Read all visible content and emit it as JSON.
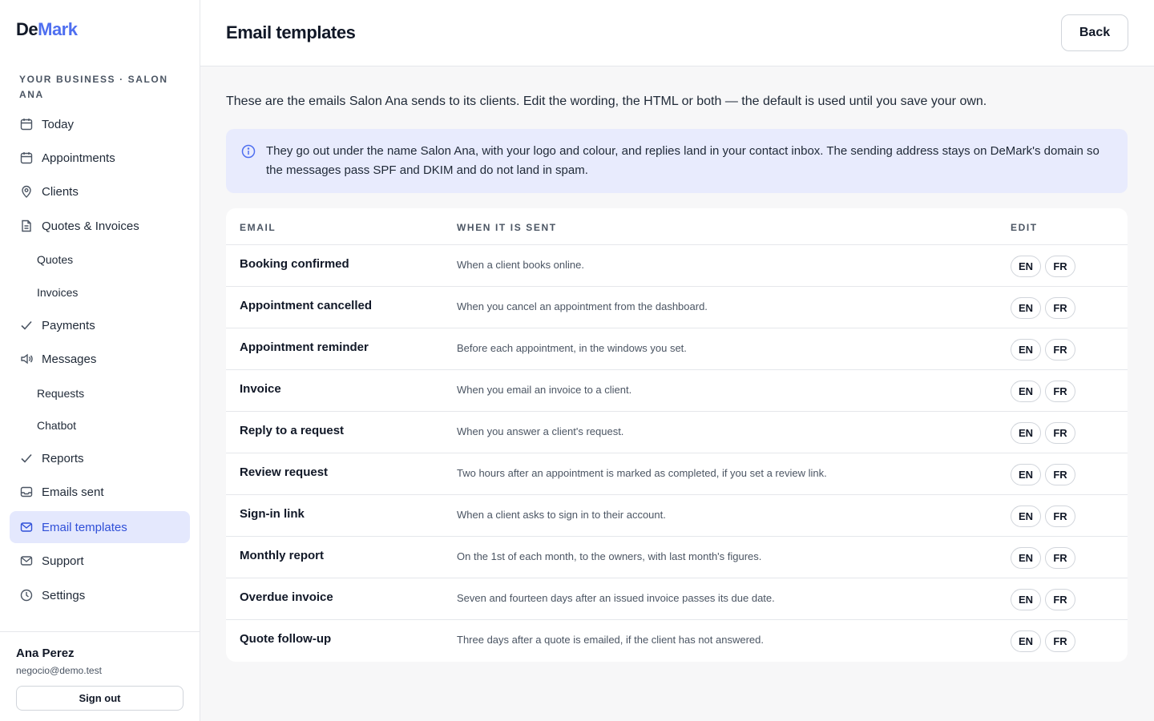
{
  "brand": {
    "part1": "De",
    "part2": "Mark"
  },
  "business_label": "YOUR BUSINESS · SALON ANA",
  "nav": [
    {
      "label": "Today",
      "icon": "calendar-icon"
    },
    {
      "label": "Appointments",
      "icon": "calendar-icon"
    },
    {
      "label": "Clients",
      "icon": "map-pin-icon"
    },
    {
      "label": "Quotes & Invoices",
      "icon": "document-icon"
    },
    {
      "label": "Quotes"
    },
    {
      "label": "Invoices"
    },
    {
      "label": "Payments",
      "icon": "check-icon"
    },
    {
      "label": "Messages",
      "icon": "speaker-icon"
    },
    {
      "label": "Requests"
    },
    {
      "label": "Chatbot"
    },
    {
      "label": "Reports",
      "icon": "check-icon"
    },
    {
      "label": "Emails sent",
      "icon": "inbox-icon"
    },
    {
      "label": "Email templates",
      "icon": "mail-icon",
      "active": true
    },
    {
      "label": "Support",
      "icon": "mail-icon"
    },
    {
      "label": "Settings",
      "icon": "clock-icon"
    }
  ],
  "user": {
    "name": "Ana Perez",
    "email": "negocio@demo.test",
    "signout_label": "Sign out"
  },
  "header": {
    "title": "Email templates",
    "back_label": "Back"
  },
  "intro": "These are the emails Salon Ana sends to its clients. Edit the wording, the HTML or both — the default is used until you save your own.",
  "info": "They go out under the name Salon Ana, with your logo and colour, and replies land in your contact inbox. The sending address stays on DeMark's domain so the messages pass SPF and DKIM and do not land in spam.",
  "table": {
    "headers": {
      "email": "EMAIL",
      "when": "WHEN IT IS SENT",
      "edit": "EDIT"
    },
    "lang_en": "EN",
    "lang_fr": "FR",
    "rows": [
      {
        "name": "Booking confirmed",
        "when": "When a client books online."
      },
      {
        "name": "Appointment cancelled",
        "when": "When you cancel an appointment from the dashboard."
      },
      {
        "name": "Appointment reminder",
        "when": "Before each appointment, in the windows you set."
      },
      {
        "name": "Invoice",
        "when": "When you email an invoice to a client."
      },
      {
        "name": "Reply to a request",
        "when": "When you answer a client's request."
      },
      {
        "name": "Review request",
        "when": "Two hours after an appointment is marked as completed, if you set a review link."
      },
      {
        "name": "Sign-in link",
        "when": "When a client asks to sign in to their account."
      },
      {
        "name": "Monthly report",
        "when": "On the 1st of each month, to the owners, with last month's figures."
      },
      {
        "name": "Overdue invoice",
        "when": "Seven and fourteen days after an issued invoice passes its due date."
      },
      {
        "name": "Quote follow-up",
        "when": "Three days after a quote is emailed, if the client has not answered."
      }
    ]
  },
  "colors": {
    "accent": "#4f6ff0",
    "active_bg": "#e4e8fd",
    "info_bg": "#e8ebfd"
  }
}
